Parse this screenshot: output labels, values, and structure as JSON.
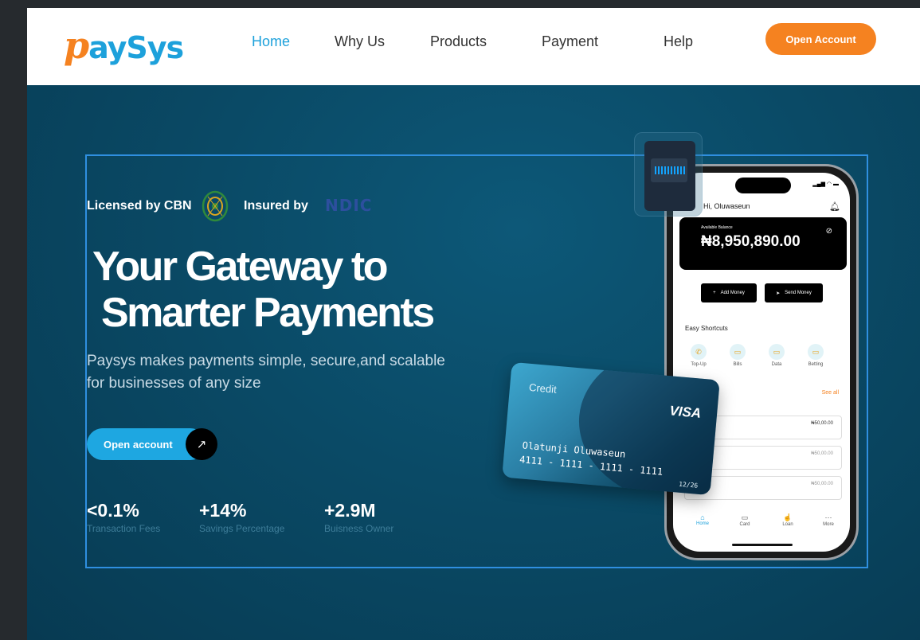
{
  "brand": {
    "logo_p": "p",
    "logo_rest": "aySys",
    "accent": "#f58220",
    "primary": "#1da1db"
  },
  "nav": {
    "items": [
      {
        "label": "Home",
        "active": true
      },
      {
        "label": "Why Us",
        "active": false
      },
      {
        "label": "Products",
        "active": false
      },
      {
        "label": "Payment",
        "active": false
      },
      {
        "label": "Help",
        "active": false
      }
    ],
    "cta_label": "Open Account"
  },
  "hero": {
    "licensed_text": "Licensed by CBN",
    "insured_text": "Insured by",
    "ndic_logo_text": "NDIC",
    "headline_line1": "Your Gateway to",
    "headline_line2": "Smarter Payments",
    "subtext": "Paysys makes payments simple, secure,and scalable for businesses of any size",
    "cta_label": "Open account",
    "cta_arrow_icon": "arrow-up-right-icon",
    "stats": [
      {
        "value": "<0.1%",
        "label": "Transaction Fees"
      },
      {
        "value": "+14%",
        "label": "Savings Percentage"
      },
      {
        "value": "+2.9M",
        "label": "Buisness Owner"
      }
    ]
  },
  "phone": {
    "greeting": "Hi, Oluwaseun",
    "balance_label": "Available Balance",
    "balance_value": "₦8,950,890.00",
    "add_money": "Add Money",
    "send_money": "Send Money",
    "shortcuts_title": "Easy Shortcuts",
    "shortcuts": [
      {
        "label": "Top-Up",
        "icon": "phone-icon"
      },
      {
        "label": "Bills",
        "icon": "tv-icon"
      },
      {
        "label": "Data",
        "icon": "tv-icon"
      },
      {
        "label": "Betting",
        "icon": "tv-icon"
      }
    ],
    "see_all": "See all",
    "transactions": [
      "₦50,00.00",
      "₦50,00.00",
      "₦50,00.00"
    ],
    "tabs": [
      {
        "label": "Home",
        "icon": "home-icon"
      },
      {
        "label": "Card",
        "icon": "card-icon"
      },
      {
        "label": "Loan",
        "icon": "loan-icon"
      },
      {
        "label": "More",
        "icon": "more-icon"
      }
    ]
  },
  "card": {
    "type": "Credit",
    "network": "VISA",
    "holder": "Olatunji Oluwaseun",
    "number": "4111 - 1111 - 1111 - 1111",
    "expiry": "12/26"
  }
}
